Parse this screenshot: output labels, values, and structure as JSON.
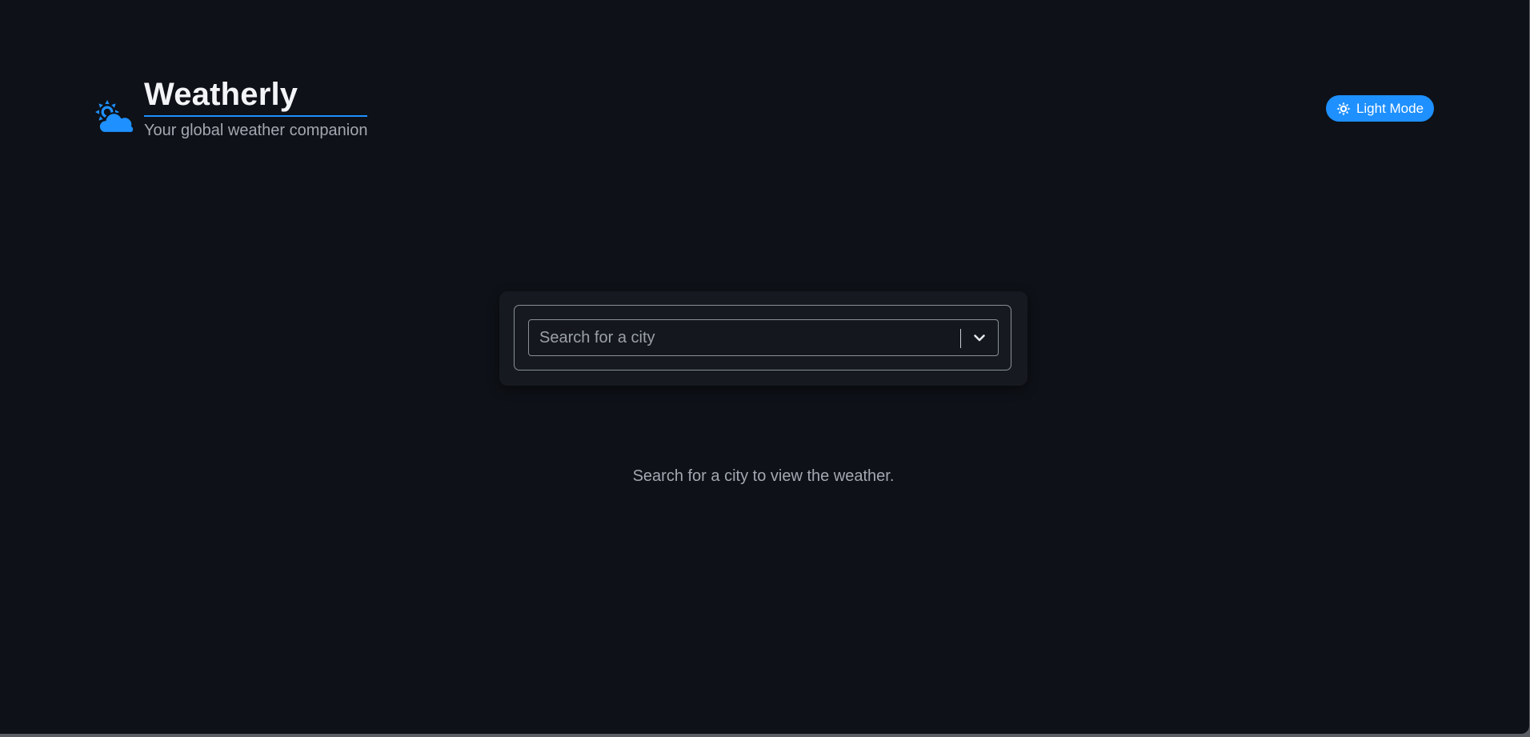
{
  "header": {
    "logo_icon": "sun-behind-cloud-icon",
    "title": "Weatherly",
    "subtitle": "Your global weather companion"
  },
  "theme_toggle": {
    "icon": "sun-icon",
    "label": "Light Mode"
  },
  "search": {
    "placeholder": "Search for a city",
    "value": "",
    "dropdown_icon": "chevron-down-icon"
  },
  "empty_state": {
    "message": "Search for a city to view the weather."
  },
  "colors": {
    "background": "#0e1117",
    "accent": "#1e90ff",
    "card": "#161a20",
    "text_primary": "#f2f4f7",
    "text_secondary": "#a3a8b0"
  }
}
